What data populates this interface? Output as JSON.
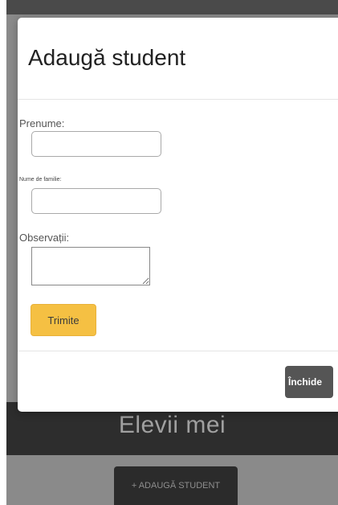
{
  "background_page": {
    "title": "Elevii mei",
    "add_button_label": "+ ADAUGĂ STUDENT"
  },
  "modal": {
    "title": "Adaugă student",
    "form": {
      "first_name_label": "Prenume:",
      "first_name_value": "",
      "last_name_label": "Nume de familie:",
      "last_name_value": "",
      "notes_label": "Observații:",
      "notes_value": "",
      "submit_label": "Trimite"
    },
    "close_label": "Închide"
  },
  "colors": {
    "submit_button": "#f5c043",
    "close_button": "#555555",
    "header_bar": "#2d2d2d"
  }
}
